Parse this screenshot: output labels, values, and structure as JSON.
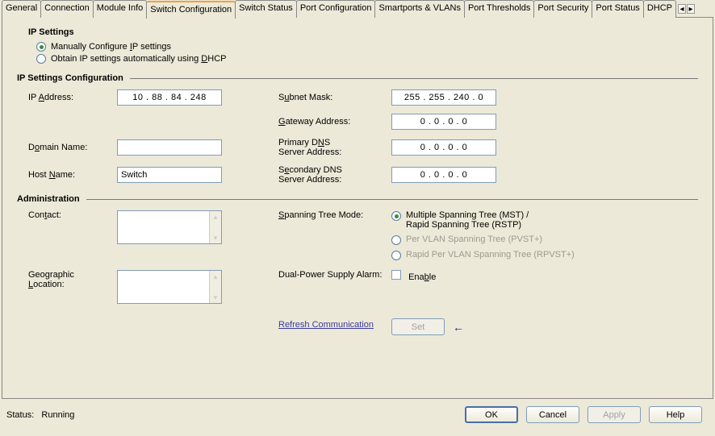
{
  "tabs": {
    "general": "General",
    "connection": "Connection",
    "module_info": "Module Info",
    "switch_config": "Switch Configuration",
    "switch_status": "Switch Status",
    "port_config": "Port Configuration",
    "smartports": "Smartports & VLANs",
    "port_thresholds": "Port Thresholds",
    "port_security": "Port Security",
    "port_status": "Port Status",
    "dhcp": "DHCP"
  },
  "ip_settings": {
    "title": "IP Settings",
    "manual": "Manually Configure IP settings",
    "dhcp": "Obtain IP settings automatically using DHCP",
    "selected": "manual"
  },
  "config": {
    "section": "IP Settings Configuration",
    "ip_label": "IP Address:",
    "ip": "10  .  88  .  84  .  248",
    "subnet_label": "Subnet Mask:",
    "subnet": "255 . 255 . 240 .   0",
    "gateway_label": "Gateway Address:",
    "gateway": "0   .   0   .   0   .   0",
    "domain_label": "Domain Name:",
    "domain": "",
    "host_label": "Host Name:",
    "host": "Switch",
    "pdns_label": "Primary DNS Server Address:",
    "pdns": "0   .   0   .   0   .   0",
    "sdns_label": "Secondary DNS Server Address:",
    "sdns": "0   .   0   .   0   .   0"
  },
  "admin": {
    "section": "Administration",
    "contact_label": "Contact:",
    "contact": "",
    "location_label": "Geographic Location:",
    "location": "",
    "stm_label": "Spanning Tree Mode:",
    "stm_mst": "Multiple Spanning Tree (MST) / Rapid Spanning Tree (RSTP)",
    "stm_pvst": "Per VLAN Spanning Tree (PVST+)",
    "stm_rpvst": "Rapid Per VLAN Spanning Tree (RPVST+)",
    "dual_power_label": "Dual-Power Supply Alarm:",
    "enable": "Enable",
    "refresh": "Refresh Communication",
    "set": "Set"
  },
  "footer": {
    "status_label": "Status:",
    "status_value": "Running",
    "ok": "OK",
    "cancel": "Cancel",
    "apply": "Apply",
    "help": "Help"
  }
}
